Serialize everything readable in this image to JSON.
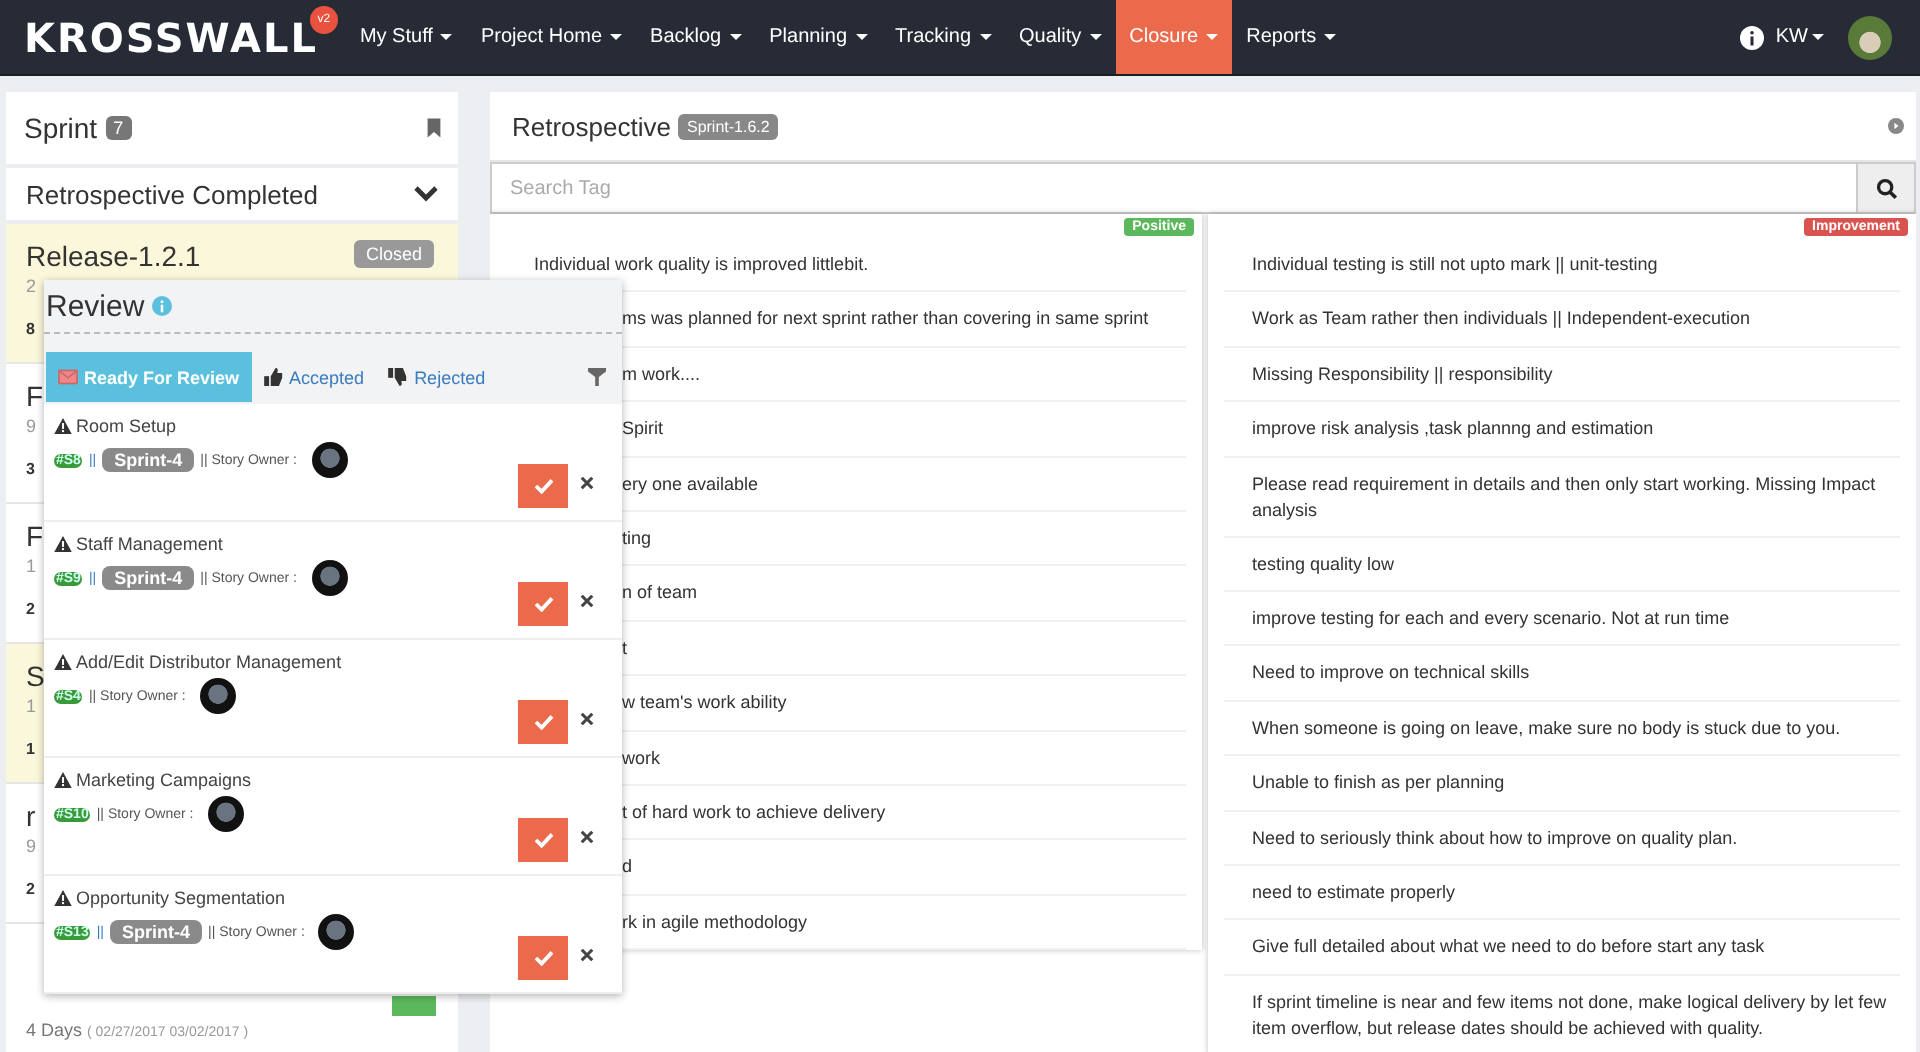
{
  "nav": {
    "logo": "KROSSWALL",
    "version": "v2",
    "user": "KW",
    "menu": [
      {
        "label": "My Stuff",
        "selected": false
      },
      {
        "label": "Project Home",
        "selected": false
      },
      {
        "label": "Backlog",
        "selected": false
      },
      {
        "label": "Planning",
        "selected": false
      },
      {
        "label": "Tracking",
        "selected": false
      },
      {
        "label": "Quality",
        "selected": false
      },
      {
        "label": "Closure",
        "selected": true
      },
      {
        "label": "Reports",
        "selected": false
      }
    ]
  },
  "sidebar": {
    "title": "Sprint",
    "count": "7",
    "section": "Retrospective Completed",
    "cards": [
      {
        "title": "Release-1.2.1",
        "status": "Closed",
        "subtitle": "2",
        "note": "8",
        "highlighted": true
      },
      {
        "title": "F",
        "subtitle": "9",
        "note": "3",
        "highlighted": false
      },
      {
        "title": "F",
        "subtitle": "1",
        "note": "2",
        "highlighted": false
      },
      {
        "title": "S",
        "subtitle": "1",
        "note": "1",
        "highlighted": true
      },
      {
        "title": "r",
        "subtitle": "9",
        "note": "2",
        "highlighted": false
      }
    ],
    "last_card": {
      "days": "4 Days",
      "dates": "( 02/27/2017 03/02/2017 )"
    }
  },
  "retrospective": {
    "title": "Retrospective",
    "sprint": "Sprint-1.6.2",
    "search": {
      "placeholder": "Search Tag"
    },
    "columns": [
      {
        "kind": "positive",
        "badge": "Positive",
        "items": [
          {
            "text": "Individual work quality is improved littlebit.",
            "covered": false
          },
          {
            "text": "ms was planned for next sprint rather than covering in same sprint",
            "covered": true
          },
          {
            "text": "m work....",
            "covered": true
          },
          {
            "text": "Spirit",
            "covered": true
          },
          {
            "text": "ery one available",
            "covered": true
          },
          {
            "text": "ting",
            "covered": true
          },
          {
            "text": "n of team",
            "covered": true
          },
          {
            "text": "t",
            "covered": true
          },
          {
            "text": "w team's work ability",
            "covered": true
          },
          {
            "text": "work",
            "covered": true
          },
          {
            "text": "t of hard work to achieve delivery",
            "covered": true
          },
          {
            "text": "d",
            "covered": true
          },
          {
            "text": "rk in agile methodology",
            "covered": true
          }
        ]
      },
      {
        "kind": "improvement",
        "badge": "Improvement",
        "items": [
          {
            "text": "Individual testing is still not upto mark || unit-testing",
            "covered": false
          },
          {
            "text": "Work as Team rather then individuals || Independent-execution",
            "covered": false
          },
          {
            "text": "Missing Responsibility || responsibility",
            "covered": false
          },
          {
            "text": "improve risk analysis ,task plannng and estimation",
            "covered": false
          },
          {
            "text": "Please read requirement in details and then only start working. Missing Impact analysis",
            "covered": false
          },
          {
            "text": "testing quality low",
            "covered": false
          },
          {
            "text": "improve testing for each and every scenario. Not at run time",
            "covered": false
          },
          {
            "text": "Need to improve on technical skills",
            "covered": false
          },
          {
            "text": "When someone is going on leave, make sure no body is stuck due to you.",
            "covered": false
          },
          {
            "text": "Unable to finish as per planning",
            "covered": false
          },
          {
            "text": "Need to seriously think about how to improve on quality plan.",
            "covered": false
          },
          {
            "text": "need to estimate properly",
            "covered": false
          },
          {
            "text": "Give full detailed about what we need to do before start any task",
            "covered": false
          },
          {
            "text": "If sprint timeline is near and few items not done, make logical delivery by let few item overflow, but release dates should be achieved with quality.",
            "covered": false
          }
        ]
      }
    ]
  },
  "review": {
    "title": "Review",
    "tabs": [
      {
        "kind": "ready",
        "label": "Ready For Review",
        "selected": true
      },
      {
        "kind": "accepted",
        "label": "Accepted",
        "selected": false
      },
      {
        "kind": "rejected",
        "label": "Rejected",
        "selected": false
      }
    ],
    "stories": [
      {
        "title": "Room Setup",
        "id": "#S8",
        "separator": "||",
        "sprint": "Sprint-4",
        "owner_label": "|| Story Owner :"
      },
      {
        "title": "Staff Management",
        "id": "#S9",
        "separator": "||",
        "sprint": "Sprint-4",
        "owner_label": "|| Story Owner :"
      },
      {
        "title": "Add/Edit Distributor Management",
        "id": "#S4",
        "owner_label": "|| Story Owner :"
      },
      {
        "title": "Marketing Campaigns",
        "id": "#S10",
        "owner_label": "|| Story Owner :"
      },
      {
        "title": "Opportunity Segmentation",
        "id": "#S13",
        "separator": "||",
        "sprint": "Sprint-4",
        "owner_label": "|| Story Owner :"
      }
    ]
  }
}
